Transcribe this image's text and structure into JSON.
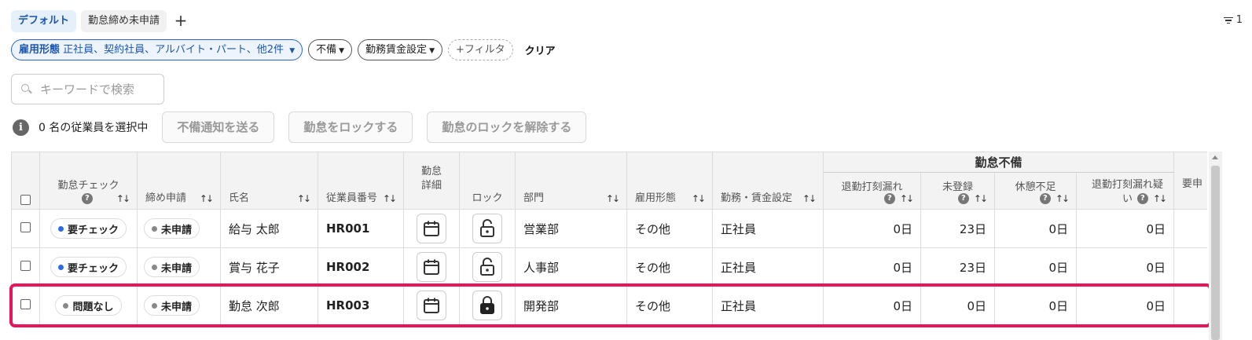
{
  "tabs": [
    {
      "label": "デフォルト",
      "active": true
    },
    {
      "label": "勤怠締め未申請",
      "active": false
    }
  ],
  "tab_add": "+",
  "filter_count": "1",
  "chips": {
    "employment_label": "雇用形態",
    "employment_value": "正社員、契約社員、アルバイト・パート、他2件",
    "deficiency": "不備",
    "work_setting": "勤務賃金設定",
    "add_filter": "+フィルタ",
    "clear": "クリア"
  },
  "search": {
    "placeholder": "キーワードで検索",
    "value": ""
  },
  "selection": {
    "text": "0 名の従業員を選択中"
  },
  "actions": {
    "notify": "不備通知を送る",
    "lock": "勤怠をロックする",
    "unlock": "勤怠のロックを解除する"
  },
  "table": {
    "headers": {
      "check": "勤怠チェック",
      "submission": "締め申請",
      "name": "氏名",
      "employee_no": "従業員番号",
      "detail": "勤怠詳細",
      "lock": "ロック",
      "department": "部門",
      "employment": "雇用形態",
      "work_setting": "勤務・賃金設定",
      "group": "勤怠不備",
      "clockout_missing": "退勤打刻漏れ",
      "unregistered": "未登録",
      "break_short": "休憩不足",
      "clockout_suspect": "退勤打刻漏れ疑い",
      "more": "要申"
    },
    "rows": [
      {
        "check": "要チェック",
        "check_color": "blue",
        "submission": "未申請",
        "name": "給与 太郎",
        "employee_no": "HR001",
        "locked": false,
        "department": "営業部",
        "employment": "その他",
        "work_setting": "正社員",
        "clockout_missing": "0日",
        "unregistered": "23日",
        "break_short": "0日",
        "clockout_suspect": "0日"
      },
      {
        "check": "要チェック",
        "check_color": "blue",
        "submission": "未申請",
        "name": "賞与 花子",
        "employee_no": "HR002",
        "locked": false,
        "department": "人事部",
        "employment": "その他",
        "work_setting": "正社員",
        "clockout_missing": "0日",
        "unregistered": "23日",
        "break_short": "0日",
        "clockout_suspect": "0日"
      },
      {
        "check": "問題なし",
        "check_color": "gray",
        "submission": "未申請",
        "name": "勤怠 次郎",
        "employee_no": "HR003",
        "locked": true,
        "department": "開発部",
        "employment": "その他",
        "work_setting": "正社員",
        "clockout_missing": "0日",
        "unregistered": "0日",
        "break_short": "0日",
        "clockout_suspect": "0日"
      }
    ]
  },
  "colors": {
    "accent": "#2d63c8",
    "highlight": "#e8145e",
    "status_blue": "#2d6ae3"
  }
}
